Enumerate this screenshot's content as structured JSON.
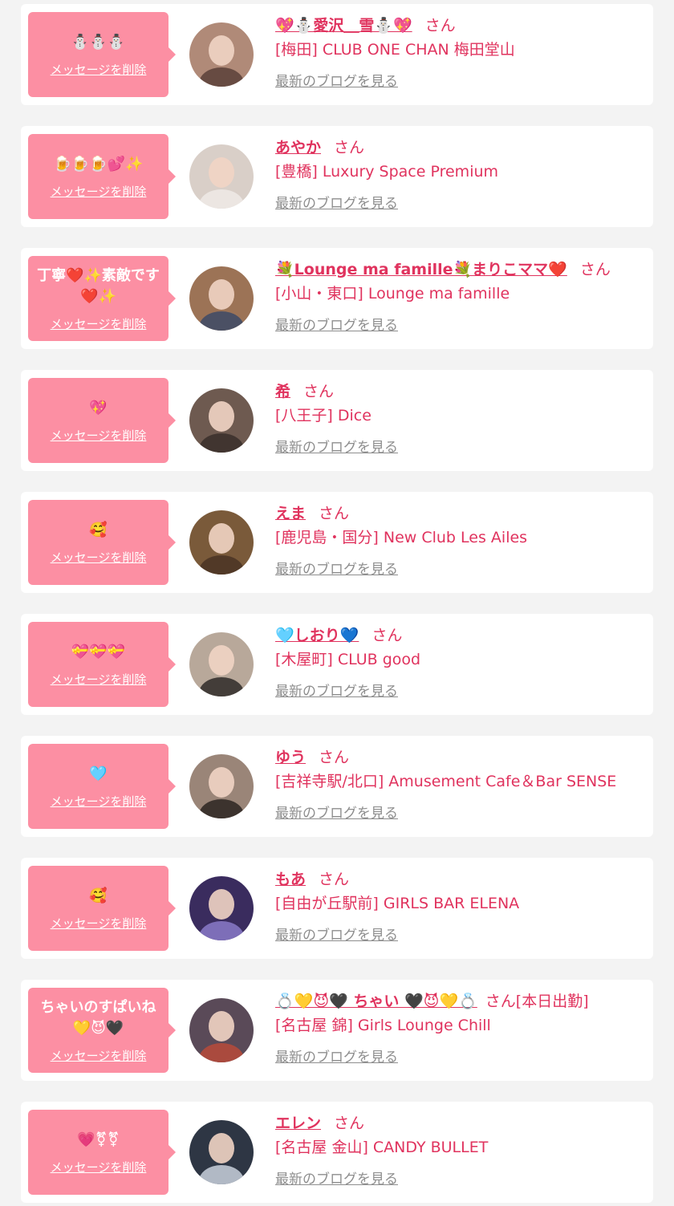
{
  "colors": {
    "page_background": "#f3f3f3",
    "card_background": "#ffffff",
    "bubble_pink": "#fc8fa3",
    "accent_text": "#e0335e",
    "link_gray": "#8e8e8e"
  },
  "labels": {
    "delete_message": "メッセージを削除",
    "view_blog": "最新のブログを見る"
  },
  "messages": [
    {
      "message": "⛄⛄⛄",
      "name": "💖⛄愛沢＿雪⛄💖",
      "suffix": "さん",
      "shop": "[梅田] CLUB ONE CHAN 梅田堂山",
      "avatar": {
        "bg": "#b08a78",
        "body": "#5a4038"
      }
    },
    {
      "message": "🍺🍺🍺💕✨",
      "name": "あやか",
      "suffix": "さん",
      "shop": "[豊橋] Luxury Space Premium",
      "avatar": {
        "bg": "#d9cfc8",
        "body": "#eeeae6"
      }
    },
    {
      "message": "丁寧❤️✨素敵です❤️✨",
      "name": "💐Lounge ma famille💐まりこママ❤️",
      "suffix": "さん",
      "shop": "[小山・東口] Lounge ma famille",
      "avatar": {
        "bg": "#9c7356",
        "body": "#3d4a66"
      }
    },
    {
      "message": "💖",
      "name": "希",
      "suffix": "さん",
      "shop": "[八王子] Dice",
      "avatar": {
        "bg": "#6e5a50",
        "body": "#3a2f2a"
      }
    },
    {
      "message": "🥰",
      "name": "えま",
      "suffix": "さん",
      "shop": "[鹿児島・国分] New Club Les Ailes",
      "avatar": {
        "bg": "#7a5a3a",
        "body": "#4a3424"
      }
    },
    {
      "message": "💝💝💝",
      "name": "🩵しおり💙",
      "suffix": "さん",
      "shop": "[木屋町] CLUB good",
      "avatar": {
        "bg": "#b8a89a",
        "body": "#2e2a28"
      }
    },
    {
      "message": "🩵",
      "name": "ゆう",
      "suffix": "さん",
      "shop": "[吉祥寺駅/北口] Amusement Cafe＆Bar SENSE",
      "avatar": {
        "bg": "#9a8578",
        "body": "#2b2421"
      }
    },
    {
      "message": "🥰",
      "name": "もあ",
      "suffix": "さん",
      "shop": "[自由が丘駅前] GIRLS BAR ELENA",
      "avatar": {
        "bg": "#3a2c5e",
        "body": "#8a7ac8"
      }
    },
    {
      "message": "ちゃいのすぱいね💛😈🖤",
      "name": "💍💛😈🖤 ちゃい 🖤😈💛💍",
      "suffix": "さん[本日出勤]",
      "shop": "[名古屋 錦] Girls Lounge Chill",
      "avatar": {
        "bg": "#5a4a58",
        "body": "#b84a3a"
      }
    },
    {
      "message": "💗⚧⚧",
      "name": "エレン",
      "suffix": "さん",
      "shop": "[名古屋 金山] CANDY BULLET",
      "avatar": {
        "bg": "#2e3644",
        "body": "#c8d0dc"
      }
    }
  ]
}
